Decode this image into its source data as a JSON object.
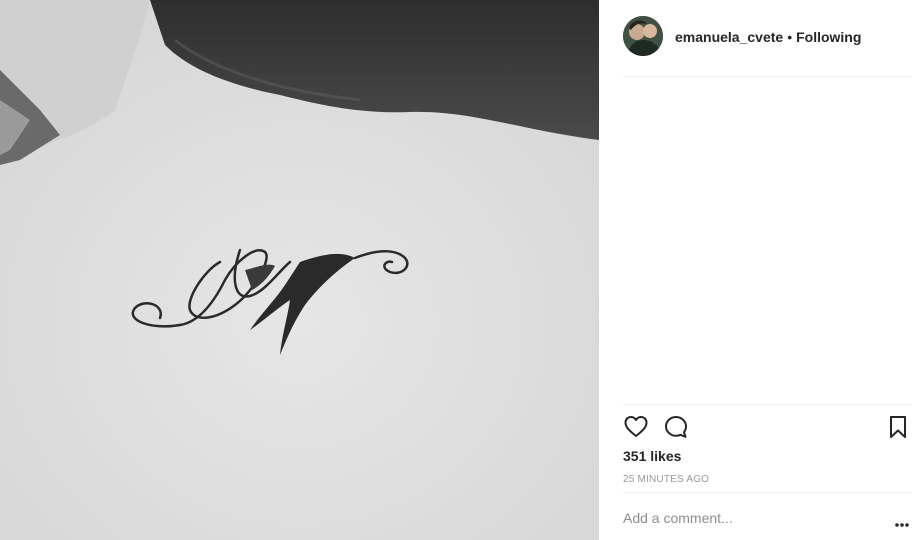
{
  "post": {
    "image_alt": "tattoo photo",
    "author": {
      "username": "emanuela_cvete",
      "separator": "•",
      "follow_status": "Following"
    },
    "likes_text": "351 likes",
    "timestamp": "25 MINUTES AGO",
    "comment_box": {
      "placeholder": "Add a comment..."
    }
  },
  "icons": {
    "like": "heart-icon",
    "comment": "speech-bubble-icon",
    "save": "bookmark-icon",
    "more": "ellipsis-icon"
  },
  "colors": {
    "text": "#262626",
    "muted": "#999999",
    "divider": "#efefef"
  }
}
